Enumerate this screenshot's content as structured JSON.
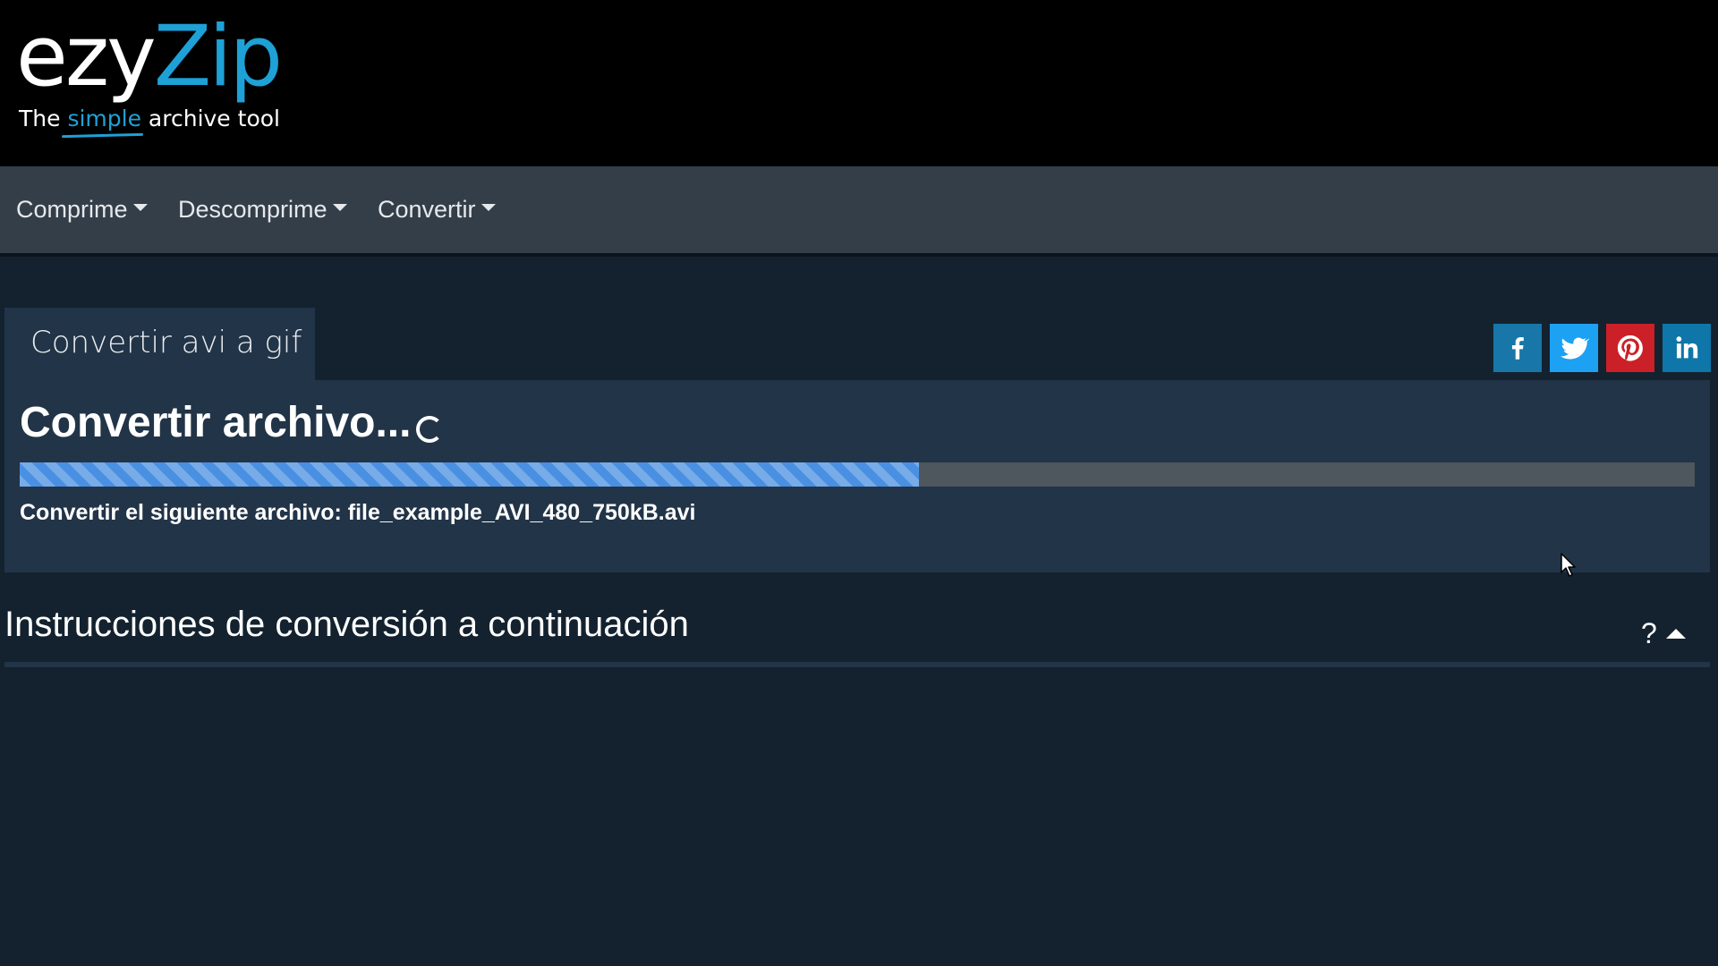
{
  "header": {
    "logo": {
      "part1": "ezy",
      "part2": "Zip"
    },
    "tagline": {
      "before": "The ",
      "highlight": "simple",
      "after": " archive tool"
    }
  },
  "nav": {
    "items": [
      {
        "label": "Comprime"
      },
      {
        "label": "Descomprime"
      },
      {
        "label": "Convertir"
      }
    ]
  },
  "tab": {
    "label": "Convertir avi a gif"
  },
  "social": [
    {
      "icon": "facebook-icon",
      "color": "#1877a8"
    },
    {
      "icon": "twitter-icon",
      "color": "#1da1f2"
    },
    {
      "icon": "pinterest-icon",
      "color": "#cb2027"
    },
    {
      "icon": "linkedin-icon",
      "color": "#0e76a8"
    }
  ],
  "panel": {
    "title": "Convertir archivo...",
    "progress_percent": 53.7,
    "status_text": "Convertir el siguiente archivo: file_example_AVI_480_750kB.avi"
  },
  "instructions": {
    "title": "Instrucciones de conversión a continuación",
    "help": "?"
  },
  "colors": {
    "background": "#14222f",
    "header": "#000000",
    "nav": "#333e49",
    "panel": "#223447",
    "accent": "#1ea1d6",
    "progress": "#4a90e2",
    "progress_track": "#4e565e"
  }
}
